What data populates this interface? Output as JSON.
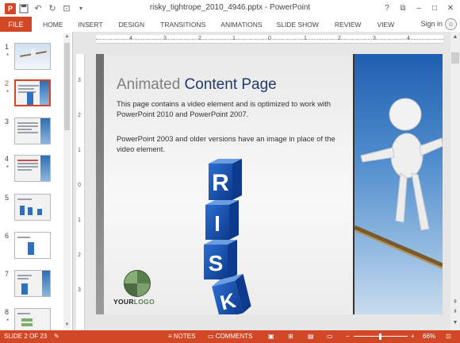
{
  "window": {
    "title": "risky_tightrope_2010_4946.pptx - PowerPoint",
    "app_icon": "P",
    "controls": [
      "?",
      "restore-ribbon-icon",
      "minimize-icon",
      "maximize-icon",
      "close-icon"
    ],
    "control_glyphs": [
      "?",
      "⧉",
      "–",
      "□",
      "✕"
    ]
  },
  "qat": {
    "undo_glyph": "↶",
    "redo_glyph": "↻",
    "save_glyph": "💾",
    "present_glyph": "⊡"
  },
  "ribbon": {
    "file_label": "FILE",
    "tabs": [
      "HOME",
      "INSERT",
      "DESIGN",
      "TRANSITIONS",
      "ANIMATIONS",
      "SLIDE SHOW",
      "REVIEW",
      "VIEW"
    ],
    "signin_label": "Sign in",
    "accent_color": "#d24726"
  },
  "thumbnails": {
    "items": [
      {
        "num": "1",
        "star": "*"
      },
      {
        "num": "2",
        "star": "*"
      },
      {
        "num": "3",
        "star": ""
      },
      {
        "num": "4",
        "star": "*"
      },
      {
        "num": "5",
        "star": ""
      },
      {
        "num": "6",
        "star": ""
      },
      {
        "num": "7",
        "star": ""
      },
      {
        "num": "8",
        "star": "*"
      }
    ]
  },
  "ruler": {
    "h_ticks": [
      "4",
      "3",
      "2",
      "1",
      "0",
      "1",
      "2",
      "3",
      "4"
    ],
    "v_ticks": [
      "3",
      "2",
      "1",
      "0",
      "1",
      "2",
      "3"
    ]
  },
  "slide": {
    "title_part1": "Animated ",
    "title_part2": "Content Page",
    "para1": "This page contains a video element and is optimized to work with PowerPoint 2010 and PowerPoint 2007.",
    "para2": "PowerPoint 2003 and older versions have an image in place of the video element.",
    "cube_letters": [
      "R",
      "I",
      "S",
      "K"
    ],
    "logo_part1": "YOUR",
    "logo_part2": "LOGO"
  },
  "status": {
    "slide_info": "SLIDE 2 OF 23",
    "notes_label": "NOTES",
    "comments_label": "COMMENTS",
    "zoom_minus": "−",
    "zoom_plus": "+",
    "zoom_level": "66%"
  }
}
